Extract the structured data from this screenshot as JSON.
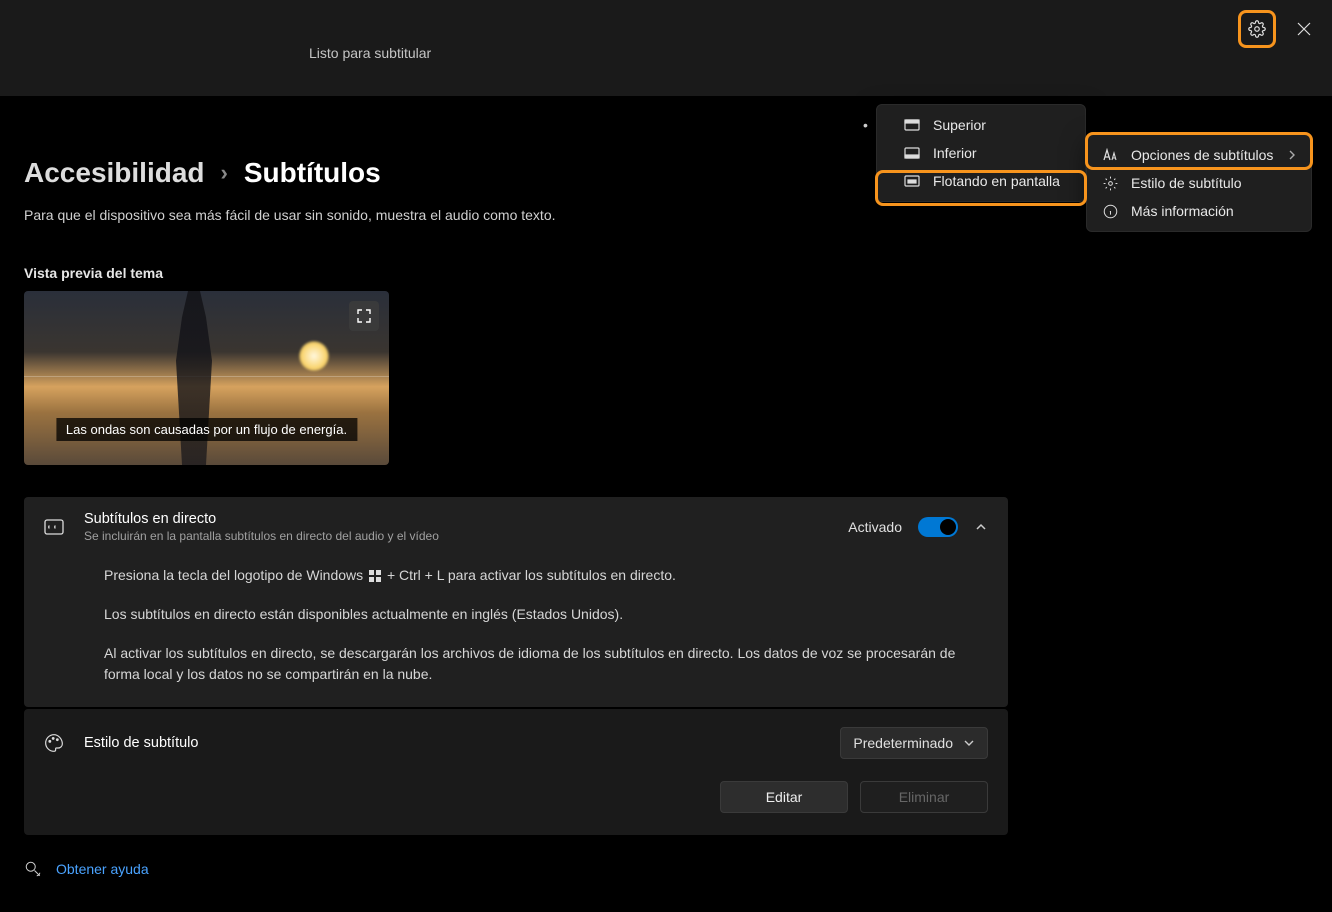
{
  "titlebar": {
    "status": "Listo para subtitular"
  },
  "breadcrumb": {
    "parent": "Accesibilidad",
    "sep": "›",
    "current": "Subtítulos"
  },
  "description": "Para que el dispositivo sea más fácil de usar sin sonido, muestra el audio como texto.",
  "preview": {
    "label": "Vista previa del tema",
    "caption": "Las ondas son causadas por un flujo de energía."
  },
  "live": {
    "title": "Subtítulos en directo",
    "sub": "Se incluirán en la pantalla subtítulos en directo del audio y el vídeo",
    "status": "Activado",
    "body1a": "Presiona la tecla del logotipo de Windows",
    "body1b": "+ Ctrl + L para activar los subtítulos en directo.",
    "body2": "Los subtítulos en directo están disponibles actualmente en inglés (Estados Unidos).",
    "body3": "Al activar los subtítulos en directo, se descargarán los archivos de idioma de los subtítulos en directo. Los datos de voz se procesarán de forma local y los datos no se compartirán en la nube."
  },
  "style": {
    "title": "Estilo de subtítulo",
    "selected": "Predeterminado",
    "edit": "Editar",
    "delete": "Eliminar"
  },
  "help": {
    "label": "Obtener ayuda"
  },
  "menu_position": {
    "top": "Superior",
    "bottom": "Inferior",
    "float": "Flotando en pantalla"
  },
  "menu_settings": {
    "options": "Opciones de subtítulos",
    "style": "Estilo de subtítulo",
    "more": "Más información"
  }
}
